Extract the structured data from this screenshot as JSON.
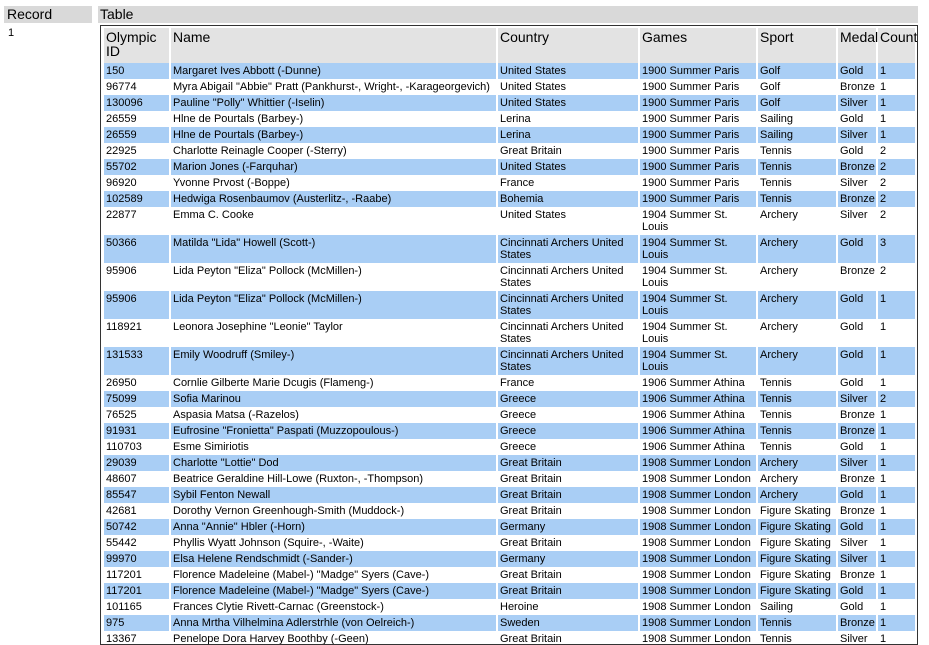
{
  "headers": {
    "record": "Record",
    "table": "Table"
  },
  "record_number": "1",
  "columns": [
    "Olympic ID",
    "Name",
    "Country",
    "Games",
    "Sport",
    "Medal",
    "Count"
  ],
  "rows": [
    {
      "id": "150",
      "name": "Margaret Ives Abbott (-Dunne)",
      "country": "United States",
      "games": "1900 Summer Paris",
      "sport": "Golf",
      "medal": "Gold",
      "count": "1",
      "hl": true
    },
    {
      "id": "96774",
      "name": "Myra Abigail \"Abbie\" Pratt (Pankhurst-, Wright-, -Karageorgevich)",
      "country": "United States",
      "games": "1900 Summer Paris",
      "sport": "Golf",
      "medal": "Bronze",
      "count": "1",
      "hl": false
    },
    {
      "id": "130096",
      "name": "Pauline \"Polly\" Whittier (-Iselin)",
      "country": "United States",
      "games": "1900 Summer Paris",
      "sport": "Golf",
      "medal": "Silver",
      "count": "1",
      "hl": true
    },
    {
      "id": "26559",
      "name": "Hlne de Pourtals (Barbey-)",
      "country": "Lerina",
      "games": "1900 Summer Paris",
      "sport": "Sailing",
      "medal": "Gold",
      "count": "1",
      "hl": false
    },
    {
      "id": "26559",
      "name": "Hlne de Pourtals (Barbey-)",
      "country": "Lerina",
      "games": "1900 Summer Paris",
      "sport": "Sailing",
      "medal": "Silver",
      "count": "1",
      "hl": true
    },
    {
      "id": "22925",
      "name": "Charlotte Reinagle Cooper (-Sterry)",
      "country": "Great Britain",
      "games": "1900 Summer Paris",
      "sport": "Tennis",
      "medal": "Gold",
      "count": "2",
      "hl": false
    },
    {
      "id": "55702",
      "name": "Marion Jones (-Farquhar)",
      "country": "United States",
      "games": "1900 Summer Paris",
      "sport": "Tennis",
      "medal": "Bronze",
      "count": "2",
      "hl": true
    },
    {
      "id": "96920",
      "name": "Yvonne Prvost (-Boppe)",
      "country": "France",
      "games": "1900 Summer Paris",
      "sport": "Tennis",
      "medal": "Silver",
      "count": "2",
      "hl": false
    },
    {
      "id": "102589",
      "name": "Hedwiga Rosenbaumov (Austerlitz-, -Raabe)",
      "country": "Bohemia",
      "games": "1900 Summer Paris",
      "sport": "Tennis",
      "medal": "Bronze",
      "count": "2",
      "hl": true
    },
    {
      "id": "22877",
      "name": "Emma C. Cooke",
      "country": "United States",
      "games": "1904 Summer St. Louis",
      "sport": "Archery",
      "medal": "Silver",
      "count": "2",
      "hl": false
    },
    {
      "id": "50366",
      "name": "Matilda \"Lida\" Howell (Scott-)",
      "country": "Cincinnati Archers United States",
      "games": "1904 Summer St. Louis",
      "sport": "Archery",
      "medal": "Gold",
      "count": "3",
      "hl": true,
      "tall": true
    },
    {
      "id": "95906",
      "name": "Lida Peyton \"Eliza\" Pollock (McMillen-)",
      "country": "Cincinnati Archers United States",
      "games": "1904 Summer St. Louis",
      "sport": "Archery",
      "medal": "Bronze",
      "count": "2",
      "hl": false,
      "tall": true
    },
    {
      "id": "95906",
      "name": "Lida Peyton \"Eliza\" Pollock (McMillen-)",
      "country": "Cincinnati Archers United States",
      "games": "1904 Summer St. Louis",
      "sport": "Archery",
      "medal": "Gold",
      "count": "1",
      "hl": true,
      "tall": true
    },
    {
      "id": "118921",
      "name": "Leonora Josephine \"Leonie\" Taylor",
      "country": "Cincinnati Archers United States",
      "games": "1904 Summer St. Louis",
      "sport": "Archery",
      "medal": "Gold",
      "count": "1",
      "hl": false,
      "tall": true
    },
    {
      "id": "131533",
      "name": "Emily Woodruff (Smiley-)",
      "country": "Cincinnati Archers United States",
      "games": "1904 Summer St. Louis",
      "sport": "Archery",
      "medal": "Gold",
      "count": "1",
      "hl": true,
      "tall": true
    },
    {
      "id": "26950",
      "name": "Cornlie Gilberte Marie Dcugis (Flameng-)",
      "country": "France",
      "games": "1906 Summer Athina",
      "sport": "Tennis",
      "medal": "Gold",
      "count": "1",
      "hl": false
    },
    {
      "id": "75099",
      "name": "Sofia Marinou",
      "country": "Greece",
      "games": "1906 Summer Athina",
      "sport": "Tennis",
      "medal": "Silver",
      "count": "2",
      "hl": true
    },
    {
      "id": "76525",
      "name": "Aspasia Matsa (-Razelos)",
      "country": "Greece",
      "games": "1906 Summer Athina",
      "sport": "Tennis",
      "medal": "Bronze",
      "count": "1",
      "hl": false
    },
    {
      "id": "91931",
      "name": "Eufrosine \"Fronietta\" Paspati (Muzzopoulous-)",
      "country": "Greece",
      "games": "1906 Summer Athina",
      "sport": "Tennis",
      "medal": "Bronze",
      "count": "1",
      "hl": true
    },
    {
      "id": "110703",
      "name": "Esme Simiriotis",
      "country": "Greece",
      "games": "1906 Summer Athina",
      "sport": "Tennis",
      "medal": "Gold",
      "count": "1",
      "hl": false
    },
    {
      "id": "29039",
      "name": "Charlotte \"Lottie\" Dod",
      "country": "Great Britain",
      "games": "1908 Summer London",
      "sport": "Archery",
      "medal": "Silver",
      "count": "1",
      "hl": true
    },
    {
      "id": "48607",
      "name": "Beatrice Geraldine Hill-Lowe (Ruxton-, -Thompson)",
      "country": "Great Britain",
      "games": "1908 Summer London",
      "sport": "Archery",
      "medal": "Bronze",
      "count": "1",
      "hl": false
    },
    {
      "id": "85547",
      "name": "Sybil Fenton Newall",
      "country": "Great Britain",
      "games": "1908 Summer London",
      "sport": "Archery",
      "medal": "Gold",
      "count": "1",
      "hl": true
    },
    {
      "id": "42681",
      "name": "Dorothy Vernon Greenhough-Smith (Muddock-)",
      "country": "Great Britain",
      "games": "1908 Summer London",
      "sport": "Figure Skating",
      "medal": "Bronze",
      "count": "1",
      "hl": false
    },
    {
      "id": "50742",
      "name": "Anna \"Annie\" Hbler (-Horn)",
      "country": "Germany",
      "games": "1908 Summer London",
      "sport": "Figure Skating",
      "medal": "Gold",
      "count": "1",
      "hl": true
    },
    {
      "id": "55442",
      "name": "Phyllis Wyatt Johnson (Squire-, -Waite)",
      "country": "Great Britain",
      "games": "1908 Summer London",
      "sport": "Figure Skating",
      "medal": "Silver",
      "count": "1",
      "hl": false
    },
    {
      "id": "99970",
      "name": "Elsa Helene Rendschmidt (-Sander-)",
      "country": "Germany",
      "games": "1908 Summer London",
      "sport": "Figure Skating",
      "medal": "Silver",
      "count": "1",
      "hl": true
    },
    {
      "id": "117201",
      "name": "Florence Madeleine (Mabel-) \"Madge\" Syers (Cave-)",
      "country": "Great Britain",
      "games": "1908 Summer London",
      "sport": "Figure Skating",
      "medal": "Bronze",
      "count": "1",
      "hl": false
    },
    {
      "id": "117201",
      "name": "Florence Madeleine (Mabel-) \"Madge\" Syers (Cave-)",
      "country": "Great Britain",
      "games": "1908 Summer London",
      "sport": "Figure Skating",
      "medal": "Gold",
      "count": "1",
      "hl": true
    },
    {
      "id": "101165",
      "name": "Frances Clytie Rivett-Carnac (Greenstock-)",
      "country": "Heroine",
      "games": "1908 Summer London",
      "sport": "Sailing",
      "medal": "Gold",
      "count": "1",
      "hl": false
    },
    {
      "id": "975",
      "name": "Anna Mrtha Vilhelmina Adlerstrhle (von Oelreich-)",
      "country": "Sweden",
      "games": "1908 Summer London",
      "sport": "Tennis",
      "medal": "Bronze",
      "count": "1",
      "hl": true
    },
    {
      "id": "13367",
      "name": "Penelope Dora Harvey Boothby (-Geen)",
      "country": "Great Britain",
      "games": "1908 Summer London",
      "sport": "Tennis",
      "medal": "Silver",
      "count": "1",
      "hl": false
    }
  ],
  "colors": {
    "row_highlight": "#a9cef5",
    "header_bg": "#e3e3e3",
    "bar_bg": "#d9d9d9"
  }
}
